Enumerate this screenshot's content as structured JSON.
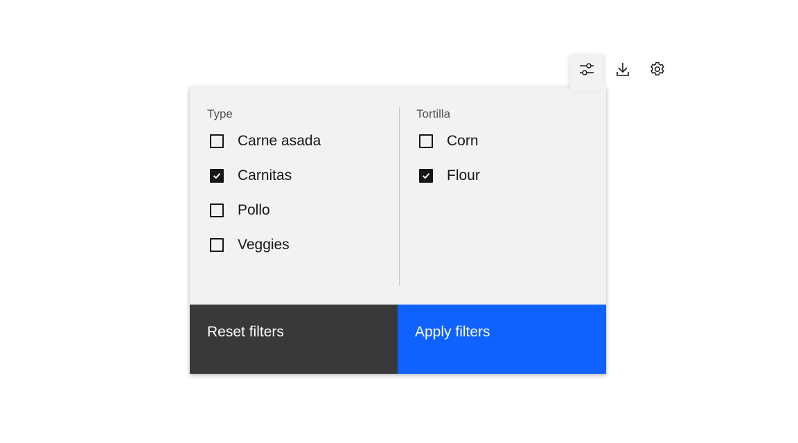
{
  "toolbar": {
    "filter_icon": "settings-adjust-icon",
    "download_icon": "download-icon",
    "settings_icon": "gear-icon"
  },
  "filter_panel": {
    "groups": [
      {
        "legend": "Type",
        "options": [
          {
            "label": "Carne asada",
            "checked": false
          },
          {
            "label": "Carnitas",
            "checked": true
          },
          {
            "label": "Pollo",
            "checked": false
          },
          {
            "label": "Veggies",
            "checked": false
          }
        ]
      },
      {
        "legend": "Tortilla",
        "options": [
          {
            "label": "Corn",
            "checked": false
          },
          {
            "label": "Flour",
            "checked": true
          }
        ]
      }
    ],
    "reset_label": "Reset filters",
    "apply_label": "Apply filters"
  },
  "colors": {
    "panel_bg": "#f2f2f2",
    "reset_bg": "#393939",
    "apply_bg": "#0f62fe",
    "text": "#161616"
  }
}
